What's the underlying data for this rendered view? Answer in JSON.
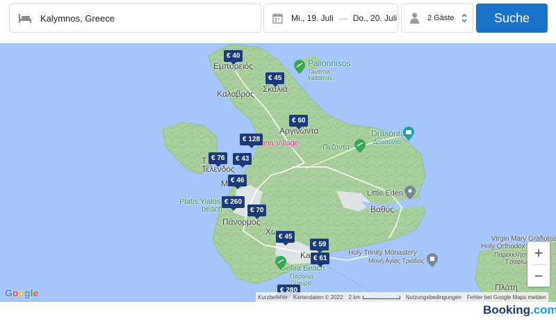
{
  "search": {
    "destination": "Kalymnos, Greece",
    "checkin": "Mi., 19. Juli",
    "dash": "—",
    "checkout": "Do., 20. Juli",
    "guests": "2 Gäste",
    "button": "Suche"
  },
  "map": {
    "labels": [
      {
        "id": "emporeios",
        "text": "Εμπορειός"
      },
      {
        "id": "palionnisos",
        "text": "Palionnisos"
      },
      {
        "id": "taverna1",
        "text": "Taverna"
      },
      {
        "id": "taverna2",
        "text": "kalidonis"
      },
      {
        "id": "skalia",
        "text": "Σκαλιά"
      },
      {
        "id": "kalavros",
        "text": "Καλαβρός"
      },
      {
        "id": "argkinonta",
        "text": "Αργινώντα"
      },
      {
        "id": "drasonta",
        "text": "Drasónta"
      },
      {
        "id": "drasonta-gr",
        "text": "Δρασόντα"
      },
      {
        "id": "lena",
        "text": "lena Village"
      },
      {
        "id": "pezonta",
        "text": "Πεζόντα"
      },
      {
        "id": "telendos1",
        "text": "Τ"
      },
      {
        "id": "telendos2",
        "text": "Τέλενδος"
      },
      {
        "id": "myrties",
        "text": "Μ"
      },
      {
        "id": "littleeden",
        "text": "Little Eden"
      },
      {
        "id": "platis1",
        "text": "Platis Yialos"
      },
      {
        "id": "platis2",
        "text": "beach"
      },
      {
        "id": "vathys",
        "text": "Βαθύς"
      },
      {
        "id": "panormos",
        "text": "Πάνορμος"
      },
      {
        "id": "chora",
        "text": "Χω"
      },
      {
        "id": "virgin1",
        "text": "Virgin Mary Grafiotissa"
      },
      {
        "id": "virgin2",
        "text": "Holy Orthodox"
      },
      {
        "id": "virgin3",
        "text": "Παρεκκλήσι"
      },
      {
        "id": "virgin4",
        "text": "Γραφιω"
      },
      {
        "id": "holytrinity1",
        "text": "Holy Trinity Monastery"
      },
      {
        "id": "holytrinity2",
        "text": "Μονή Αγίας Τριάδος"
      },
      {
        "id": "kali",
        "text": "Kal"
      },
      {
        "id": "gefira1",
        "text": "Gefira Beach"
      },
      {
        "id": "gefira2",
        "text": "Παραλία"
      },
      {
        "id": "gefira3",
        "text": "Γέφυρα"
      },
      {
        "id": "plati",
        "text": "Πλάτη"
      }
    ],
    "prices": [
      {
        "id": "p40",
        "text": "€ 40"
      },
      {
        "id": "p45a",
        "text": "€ 45"
      },
      {
        "id": "p60",
        "text": "€ 60"
      },
      {
        "id": "p128",
        "text": "€ 128"
      },
      {
        "id": "p76",
        "text": "€ 76"
      },
      {
        "id": "p43",
        "text": "€ 43"
      },
      {
        "id": "p46",
        "text": "€ 46"
      },
      {
        "id": "p260",
        "text": "€ 260"
      },
      {
        "id": "p70",
        "text": "€ 70"
      },
      {
        "id": "p45b",
        "text": "€ 45"
      },
      {
        "id": "p59",
        "text": "€ 59"
      },
      {
        "id": "p61",
        "text": "€ 61"
      },
      {
        "id": "p280",
        "text": "€ 280"
      }
    ],
    "attribution": {
      "shortcuts": "Kurzbefehle",
      "mapdata": "Kartendaten © 2022",
      "scale": "2 km",
      "terms": "Nutzungsbedingungen",
      "report": "Fehler bei Google Maps melden"
    },
    "zoom_in": "+",
    "zoom_out": "−",
    "google_logo": "Google"
  },
  "brand": {
    "name": "Booking",
    "suffix": ".com"
  },
  "colors": {
    "sea": "#a4c6fb",
    "land": "#b5d6a7",
    "pin": "#1b3a7a",
    "button": "#1a73c8"
  }
}
